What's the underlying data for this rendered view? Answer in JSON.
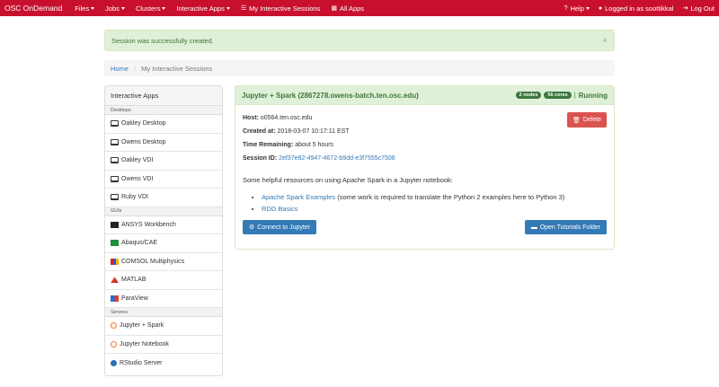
{
  "navbar": {
    "brand": "OSC OnDemand",
    "menus": [
      {
        "label": "Files"
      },
      {
        "label": "Jobs"
      },
      {
        "label": "Clusters"
      },
      {
        "label": "Interactive Apps"
      }
    ],
    "my_sessions": "My Interactive Sessions",
    "all_apps": "All Apps",
    "help": "Help",
    "logged_in": "Logged in as soottikkal",
    "logout": "Log Out"
  },
  "alert": {
    "message": "Session was successfully created.",
    "close": "×"
  },
  "breadcrumb": {
    "home": "Home",
    "separator": "/",
    "current": "My Interactive Sessions"
  },
  "sidebar": {
    "title": "Interactive Apps",
    "groups": [
      {
        "label": "Desktops",
        "items": [
          {
            "label": "Oakley Desktop",
            "icon": "desktop-icon"
          },
          {
            "label": "Owens Desktop",
            "icon": "desktop-icon"
          },
          {
            "label": "Oakley VDI",
            "icon": "desktop-icon"
          },
          {
            "label": "Owens VDI",
            "icon": "desktop-icon"
          },
          {
            "label": "Ruby VDI",
            "icon": "desktop-icon"
          }
        ]
      },
      {
        "label": "GUIs",
        "items": [
          {
            "label": "ANSYS Workbench",
            "icon": "ansys-icon"
          },
          {
            "label": "Abaqus/CAE",
            "icon": "abaqus-icon"
          },
          {
            "label": "COMSOL Multiphysics",
            "icon": "comsol-icon"
          },
          {
            "label": "MATLAB",
            "icon": "matlab-icon"
          },
          {
            "label": "ParaView",
            "icon": "paraview-icon"
          }
        ]
      },
      {
        "label": "Servers",
        "items": [
          {
            "label": "Jupyter + Spark",
            "icon": "jupyter-icon"
          },
          {
            "label": "Jupyter Notebook",
            "icon": "jupyter-icon"
          },
          {
            "label": "RStudio Server",
            "icon": "rstudio-icon"
          }
        ]
      }
    ]
  },
  "session": {
    "title": "Jupyter + Spark (2867278.owens-batch.ten.osc.edu)",
    "nodes": "2 nodes",
    "cores": "56 cores",
    "separator": "|",
    "status": "Running",
    "delete_label": "Delete",
    "host_label": "Host:",
    "host": "o0564.ten.osc.edu",
    "created_label": "Created at:",
    "created": "2018-03-07 10:17:11 EST",
    "remaining_label": "Time Remaining:",
    "remaining": "about 5 hours",
    "session_id_label": "Session ID:",
    "session_id": "2ef37e82-4947-4672-b9dd-e3f7555c7508",
    "intro": "Some helpful resources on using Apache Spark in a Jupyter notebook:",
    "resources": [
      {
        "link": "Apache Spark Examples",
        "note": " (some work is required to translate the Python 2 examples here to Python 3)"
      },
      {
        "link": "RDD Basics",
        "note": ""
      }
    ],
    "connect_label": "Connect to Jupyter",
    "tutorials_label": "Open Tutorials Folder"
  },
  "colors": {
    "navbar": "#c8102e",
    "success_bg": "#dff0d8",
    "success_text": "#3c763d",
    "primary": "#337ab7",
    "danger": "#d9534f"
  }
}
